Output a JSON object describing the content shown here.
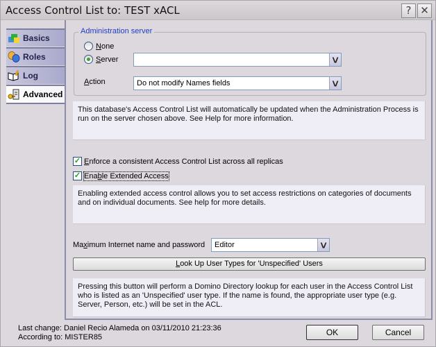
{
  "window": {
    "title": "Access Control List to: TEST xACL",
    "help_label": "?",
    "close_label": "✕"
  },
  "tabs": [
    {
      "label": "Basics",
      "icon": "basics-icon",
      "active": false
    },
    {
      "label": "Roles",
      "icon": "roles-icon",
      "active": false
    },
    {
      "label": "Log",
      "icon": "log-icon",
      "active": false
    },
    {
      "label": "Advanced",
      "icon": "advanced-icon",
      "active": true
    }
  ],
  "admin_server": {
    "legend": "Administration server",
    "none_label_u": "N",
    "none_label_rest": "one",
    "server_label_u": "S",
    "server_label_rest": "erver",
    "selected": "Server",
    "server_value": "",
    "action_label_u": "A",
    "action_label_rest": "ction",
    "action_value": "Do not modify Names fields"
  },
  "admin_info": "This database's Access Control List will automatically be updated when the Administration Process is run on the server chosen above. See Help for more information.",
  "enforce": {
    "label_u": "E",
    "label_rest": "nforce a consistent Access Control List across all replicas",
    "checked": true
  },
  "extended": {
    "label_pre": "Ena",
    "label_u": "b",
    "label_rest": "le Extended Access",
    "checked": true
  },
  "extended_info": "Enabling extended access control allows you to set access restrictions on categories of documents and on individual documents. See help for more details.",
  "max_internet": {
    "label_pre": "Ma",
    "label_u": "x",
    "label_rest": "imum Internet name and password",
    "value": "Editor"
  },
  "lookup_button": {
    "label_u": "L",
    "label_rest": "ook Up User Types for 'Unspecified' Users"
  },
  "lookup_info": "Pressing this button will perform a Domino Directory lookup for each user in the Access Control List who is listed as an 'Unspecified' user type.  If the name is found, the appropriate user type (e.g. Server, Person, etc.) will be set in the ACL.",
  "footer": {
    "last_change": "Last change: Daniel Recio Alameda on 03/11/2010 21:23:36",
    "according_to": "According to: MISTER85",
    "ok_label": "OK",
    "cancel_label": "Cancel"
  },
  "colors": {
    "legend": "#2040c0",
    "tab_border": "#7d7fa0",
    "check_mark": "#21a121"
  }
}
